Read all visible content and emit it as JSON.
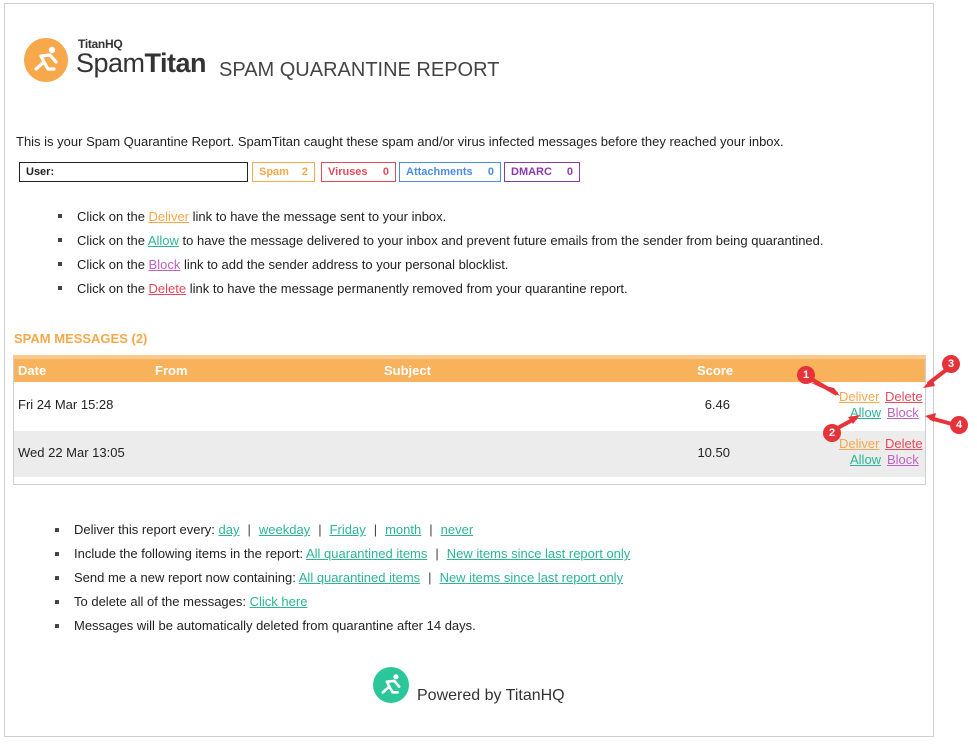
{
  "brand": {
    "company": "TitanHQ",
    "product_light": "Spam",
    "product_bold": "Titan",
    "report_title": "SPAM QUARANTINE REPORT",
    "logo_icon": "runner-icon",
    "accent": "#f6a84a",
    "teal": "#2bb596"
  },
  "intro": "This is your Spam Quarantine Report. SpamTitan caught these spam and/or virus infected messages before they reached your inbox.",
  "summary": {
    "user_label": "User:",
    "spam_label": "Spam",
    "spam_count": "2",
    "viruses_label": "Viruses",
    "viruses_count": "0",
    "attachments_label": "Attachments",
    "attachments_count": "0",
    "dmarc_label": "DMARC",
    "dmarc_count": "0"
  },
  "instructions": [
    {
      "pre": "Click on the ",
      "link": "Deliver",
      "post": " link to have the message sent to your inbox."
    },
    {
      "pre": "Click on the ",
      "link": "Allow",
      "post": " to have the message delivered to your inbox and prevent future emails from the sender from being quarantined."
    },
    {
      "pre": "Click on the ",
      "link": "Block",
      "post": " link to add the sender address to your personal blocklist."
    },
    {
      "pre": "Click on the ",
      "link": "Delete",
      "post": " link to have the message permanently removed from your quarantine report."
    }
  ],
  "spam_section": {
    "title": "SPAM MESSAGES (2)",
    "columns": [
      "Date",
      "From",
      "Subject",
      "Score"
    ],
    "rows": [
      {
        "date": "Fri 24 Mar 15:28",
        "from": "",
        "subject": "",
        "score": "6.46",
        "deliver": "Deliver",
        "delete": "Delete",
        "allow": "Allow",
        "block": "Block"
      },
      {
        "date": "Wed 22 Mar 13:05",
        "from": "",
        "subject": "",
        "score": "10.50",
        "deliver": "Deliver",
        "delete": "Delete",
        "allow": "Allow",
        "block": "Block"
      }
    ]
  },
  "callouts": [
    "1",
    "2",
    "3",
    "4"
  ],
  "settings": {
    "frequency_label": "Deliver this report every:",
    "frequency_options": [
      "day",
      "weekday",
      "Friday",
      "month",
      "never"
    ],
    "include_label": "Include the following items in the report:",
    "include_options": [
      "All quarantined items",
      "New items since last report only"
    ],
    "send_now_label": "Send me a new report now containing:",
    "send_now_options": [
      "All quarantined items",
      "New items since last report only"
    ],
    "delete_label": "To delete all of the messages:",
    "delete_link": "Click here",
    "retention_note": "Messages will be automatically deleted from quarantine after 14 days."
  },
  "footer": {
    "powered_by": "Powered by TitanHQ",
    "icon": "runner-icon"
  }
}
